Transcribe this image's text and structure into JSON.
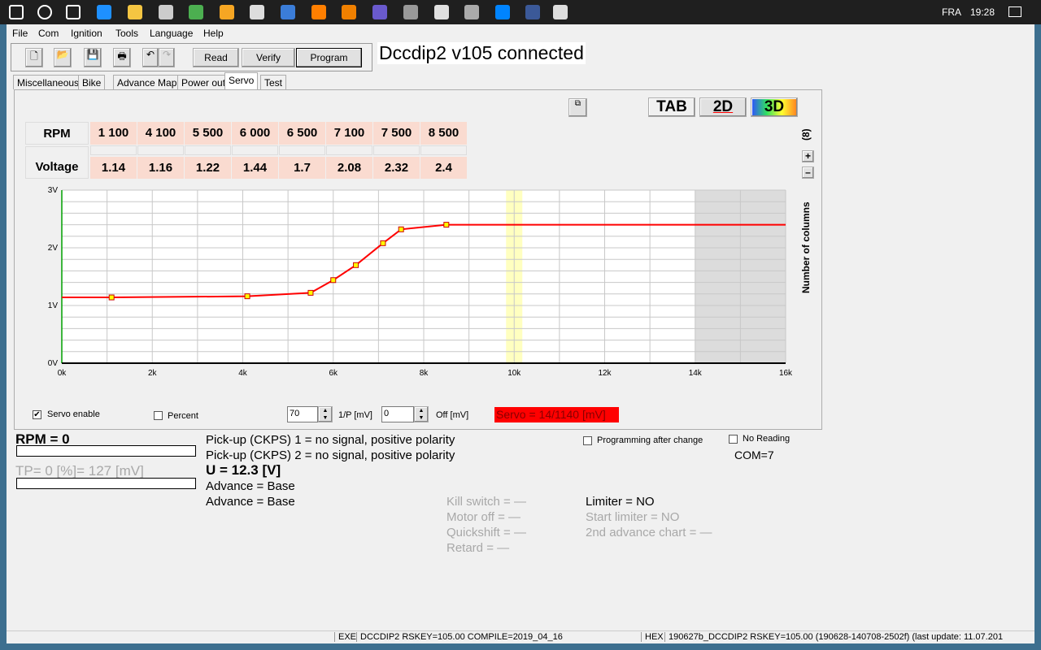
{
  "taskbar": {
    "lang": "FRA",
    "time": "19:28",
    "icons": [
      "windows-start",
      "cortana",
      "task-view",
      "edge",
      "file-explorer",
      "store",
      "chrome",
      "app",
      "mail",
      "app",
      "vlc",
      "media",
      "app",
      "app",
      "itunes",
      "app",
      "messenger",
      "app",
      "dccdip"
    ]
  },
  "menu": [
    "File",
    "Com",
    "Ignition",
    "Tools",
    "Language",
    "Help"
  ],
  "toolbar": {
    "read": "Read",
    "verify": "Verify",
    "program": "Program"
  },
  "connection_title": "Dccdip2 v105 connected",
  "tabs": [
    "Miscellaneous",
    "Bike",
    "Advance Map",
    "Power out",
    "Servo",
    "Test"
  ],
  "active_tab": "Servo",
  "view_buttons": {
    "tab": "TAB",
    "twod": "2D",
    "threed": "3D"
  },
  "columns": {
    "label": "Number of columns",
    "count": "(8)",
    "plus": "+",
    "minus": "–"
  },
  "table": {
    "rpm_label": "RPM",
    "voltage_label": "Voltage",
    "rpm": [
      "1 100",
      "4 100",
      "5 500",
      "6 000",
      "6 500",
      "7 100",
      "7 500",
      "8 500"
    ],
    "voltage": [
      "1.14",
      "1.16",
      "1.22",
      "1.44",
      "1.7",
      "2.08",
      "2.32",
      "2.4"
    ]
  },
  "chart_data": {
    "type": "line",
    "x": [
      1100,
      4100,
      5500,
      6000,
      6500,
      7100,
      7500,
      8500
    ],
    "y": [
      1.14,
      1.16,
      1.22,
      1.44,
      1.7,
      2.08,
      2.32,
      2.4
    ],
    "xlim": [
      0,
      16000
    ],
    "ylim": [
      0,
      3
    ],
    "xticks": [
      "0k",
      "2k",
      "4k",
      "6k",
      "8k",
      "10k",
      "12k",
      "14k",
      "16k"
    ],
    "yticks": [
      "0V",
      "1V",
      "2V",
      "3V"
    ],
    "grid": true,
    "line_color": "#ff0000",
    "marker_color": "#ffff00",
    "highlight_rpm": 10000,
    "disabled_range": [
      14000,
      16000
    ]
  },
  "servo": {
    "enable_label": "Servo enable",
    "enable_checked": true,
    "percent_label": "Percent",
    "percent_checked": false,
    "ip_value": "70",
    "ip_label": "1/P [mV]",
    "off_value": "0",
    "off_label": "Off [mV]",
    "status": "Servo = 14/1140 [mV]"
  },
  "info": {
    "rpm": "RPM = 0",
    "tp": "TP= 0 [%]= 127 [mV]",
    "pickup1": "Pick-up (CKPS) 1 = no signal, positive polarity",
    "pickup2": "Pick-up (CKPS) 2 = no signal, positive polarity",
    "voltage": "U = 12.3 [V]",
    "advance1": "Advance = Base",
    "advance2": "Advance = Base",
    "kill": "Kill switch = —",
    "motor": "Motor off = —",
    "quickshift": "Quickshift = —",
    "retard": "Retard = —",
    "limiter": "Limiter = NO",
    "start_limiter": "Start limiter = NO",
    "second_adv": "2nd advance chart = —",
    "prog_after": "Programming after change",
    "no_reading": "No Reading",
    "com": "COM=7"
  },
  "status": {
    "exe": "EXE",
    "exe_info": "DCCDIP2   RSKEY=105.00   COMPILE=2019_04_16",
    "hex": "HEX",
    "hex_info": "190627b_DCCDIP2   RSKEY=105.00   (190628-140708-2502f)   (last update: 11.07.201"
  }
}
